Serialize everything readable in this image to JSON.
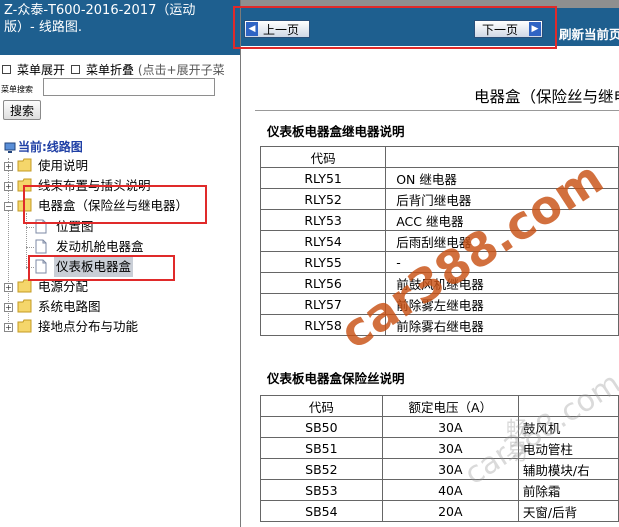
{
  "left_header": {
    "line1": "Z-众泰-T600-2016-2017（运动",
    "line2": "版）- 线路图."
  },
  "menu": {
    "expand": "菜单展开",
    "collapse": "菜单折叠",
    "hint": "(点击+展开子菜"
  },
  "search": {
    "label": "菜单搜索",
    "button": "搜索",
    "value": ""
  },
  "tree": {
    "root": "当前:线路图",
    "items": [
      {
        "label": "使用说明"
      },
      {
        "label": "线束布置与插头说明"
      },
      {
        "label": "电器盒（保险丝与继电器）"
      },
      {
        "label": "位置图"
      },
      {
        "label": "发动机舱电器盒"
      },
      {
        "label": "仪表板电器盒"
      },
      {
        "label": "电源分配"
      },
      {
        "label": "系统电路图"
      },
      {
        "label": "接地点分布与功能"
      }
    ]
  },
  "toolbar": {
    "prev": "上一页",
    "next": "下一页",
    "refresh": "刷新当前页"
  },
  "doc": {
    "title": "电器盒（保险丝与继电器）",
    "relay_heading": "仪表板电器盒继电器说明",
    "relay_header": [
      "代码",
      ""
    ],
    "relay_rows": [
      [
        "RLY51",
        "ON 继电器"
      ],
      [
        "RLY52",
        "后背门继电器"
      ],
      [
        "RLY53",
        "ACC 继电器"
      ],
      [
        "RLY54",
        "后雨刮继电器"
      ],
      [
        "RLY55",
        "-"
      ],
      [
        "RLY56",
        "前鼓风机继电器"
      ],
      [
        "RLY57",
        "前除雾左继电器"
      ],
      [
        "RLY58",
        "前除雾右继电器"
      ]
    ],
    "fuse_heading": "仪表板电器盒保险丝说明",
    "fuse_header": [
      "代码",
      "额定电压（A）",
      ""
    ],
    "fuse_rows": [
      [
        "SB50",
        "30A",
        "鼓风机"
      ],
      [
        "SB51",
        "30A",
        "电动管柱"
      ],
      [
        "SB52",
        "30A",
        "辅助模块/右"
      ],
      [
        "SB53",
        "40A",
        "前除霜"
      ],
      [
        "SB54",
        "20A",
        "天窗/后背"
      ]
    ]
  },
  "watermark": {
    "main": "car388.com",
    "secondary": "car388.com",
    "vertical": "畅易"
  }
}
